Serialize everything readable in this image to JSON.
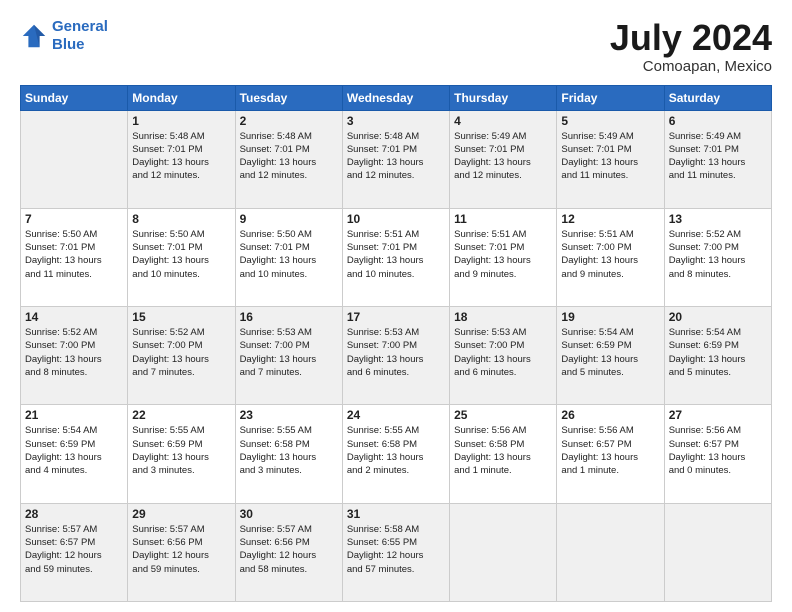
{
  "header": {
    "logo_line1": "General",
    "logo_line2": "Blue",
    "title": "July 2024",
    "subtitle": "Comoapan, Mexico"
  },
  "days_of_week": [
    "Sunday",
    "Monday",
    "Tuesday",
    "Wednesday",
    "Thursday",
    "Friday",
    "Saturday"
  ],
  "weeks": [
    [
      {
        "day": "",
        "info": ""
      },
      {
        "day": "1",
        "info": "Sunrise: 5:48 AM\nSunset: 7:01 PM\nDaylight: 13 hours\nand 12 minutes."
      },
      {
        "day": "2",
        "info": "Sunrise: 5:48 AM\nSunset: 7:01 PM\nDaylight: 13 hours\nand 12 minutes."
      },
      {
        "day": "3",
        "info": "Sunrise: 5:48 AM\nSunset: 7:01 PM\nDaylight: 13 hours\nand 12 minutes."
      },
      {
        "day": "4",
        "info": "Sunrise: 5:49 AM\nSunset: 7:01 PM\nDaylight: 13 hours\nand 12 minutes."
      },
      {
        "day": "5",
        "info": "Sunrise: 5:49 AM\nSunset: 7:01 PM\nDaylight: 13 hours\nand 11 minutes."
      },
      {
        "day": "6",
        "info": "Sunrise: 5:49 AM\nSunset: 7:01 PM\nDaylight: 13 hours\nand 11 minutes."
      }
    ],
    [
      {
        "day": "7",
        "info": "Sunrise: 5:50 AM\nSunset: 7:01 PM\nDaylight: 13 hours\nand 11 minutes."
      },
      {
        "day": "8",
        "info": "Sunrise: 5:50 AM\nSunset: 7:01 PM\nDaylight: 13 hours\nand 10 minutes."
      },
      {
        "day": "9",
        "info": "Sunrise: 5:50 AM\nSunset: 7:01 PM\nDaylight: 13 hours\nand 10 minutes."
      },
      {
        "day": "10",
        "info": "Sunrise: 5:51 AM\nSunset: 7:01 PM\nDaylight: 13 hours\nand 10 minutes."
      },
      {
        "day": "11",
        "info": "Sunrise: 5:51 AM\nSunset: 7:01 PM\nDaylight: 13 hours\nand 9 minutes."
      },
      {
        "day": "12",
        "info": "Sunrise: 5:51 AM\nSunset: 7:00 PM\nDaylight: 13 hours\nand 9 minutes."
      },
      {
        "day": "13",
        "info": "Sunrise: 5:52 AM\nSunset: 7:00 PM\nDaylight: 13 hours\nand 8 minutes."
      }
    ],
    [
      {
        "day": "14",
        "info": "Sunrise: 5:52 AM\nSunset: 7:00 PM\nDaylight: 13 hours\nand 8 minutes."
      },
      {
        "day": "15",
        "info": "Sunrise: 5:52 AM\nSunset: 7:00 PM\nDaylight: 13 hours\nand 7 minutes."
      },
      {
        "day": "16",
        "info": "Sunrise: 5:53 AM\nSunset: 7:00 PM\nDaylight: 13 hours\nand 7 minutes."
      },
      {
        "day": "17",
        "info": "Sunrise: 5:53 AM\nSunset: 7:00 PM\nDaylight: 13 hours\nand 6 minutes."
      },
      {
        "day": "18",
        "info": "Sunrise: 5:53 AM\nSunset: 7:00 PM\nDaylight: 13 hours\nand 6 minutes."
      },
      {
        "day": "19",
        "info": "Sunrise: 5:54 AM\nSunset: 6:59 PM\nDaylight: 13 hours\nand 5 minutes."
      },
      {
        "day": "20",
        "info": "Sunrise: 5:54 AM\nSunset: 6:59 PM\nDaylight: 13 hours\nand 5 minutes."
      }
    ],
    [
      {
        "day": "21",
        "info": "Sunrise: 5:54 AM\nSunset: 6:59 PM\nDaylight: 13 hours\nand 4 minutes."
      },
      {
        "day": "22",
        "info": "Sunrise: 5:55 AM\nSunset: 6:59 PM\nDaylight: 13 hours\nand 3 minutes."
      },
      {
        "day": "23",
        "info": "Sunrise: 5:55 AM\nSunset: 6:58 PM\nDaylight: 13 hours\nand 3 minutes."
      },
      {
        "day": "24",
        "info": "Sunrise: 5:55 AM\nSunset: 6:58 PM\nDaylight: 13 hours\nand 2 minutes."
      },
      {
        "day": "25",
        "info": "Sunrise: 5:56 AM\nSunset: 6:58 PM\nDaylight: 13 hours\nand 1 minute."
      },
      {
        "day": "26",
        "info": "Sunrise: 5:56 AM\nSunset: 6:57 PM\nDaylight: 13 hours\nand 1 minute."
      },
      {
        "day": "27",
        "info": "Sunrise: 5:56 AM\nSunset: 6:57 PM\nDaylight: 13 hours\nand 0 minutes."
      }
    ],
    [
      {
        "day": "28",
        "info": "Sunrise: 5:57 AM\nSunset: 6:57 PM\nDaylight: 12 hours\nand 59 minutes."
      },
      {
        "day": "29",
        "info": "Sunrise: 5:57 AM\nSunset: 6:56 PM\nDaylight: 12 hours\nand 59 minutes."
      },
      {
        "day": "30",
        "info": "Sunrise: 5:57 AM\nSunset: 6:56 PM\nDaylight: 12 hours\nand 58 minutes."
      },
      {
        "day": "31",
        "info": "Sunrise: 5:58 AM\nSunset: 6:55 PM\nDaylight: 12 hours\nand 57 minutes."
      },
      {
        "day": "",
        "info": ""
      },
      {
        "day": "",
        "info": ""
      },
      {
        "day": "",
        "info": ""
      }
    ]
  ]
}
